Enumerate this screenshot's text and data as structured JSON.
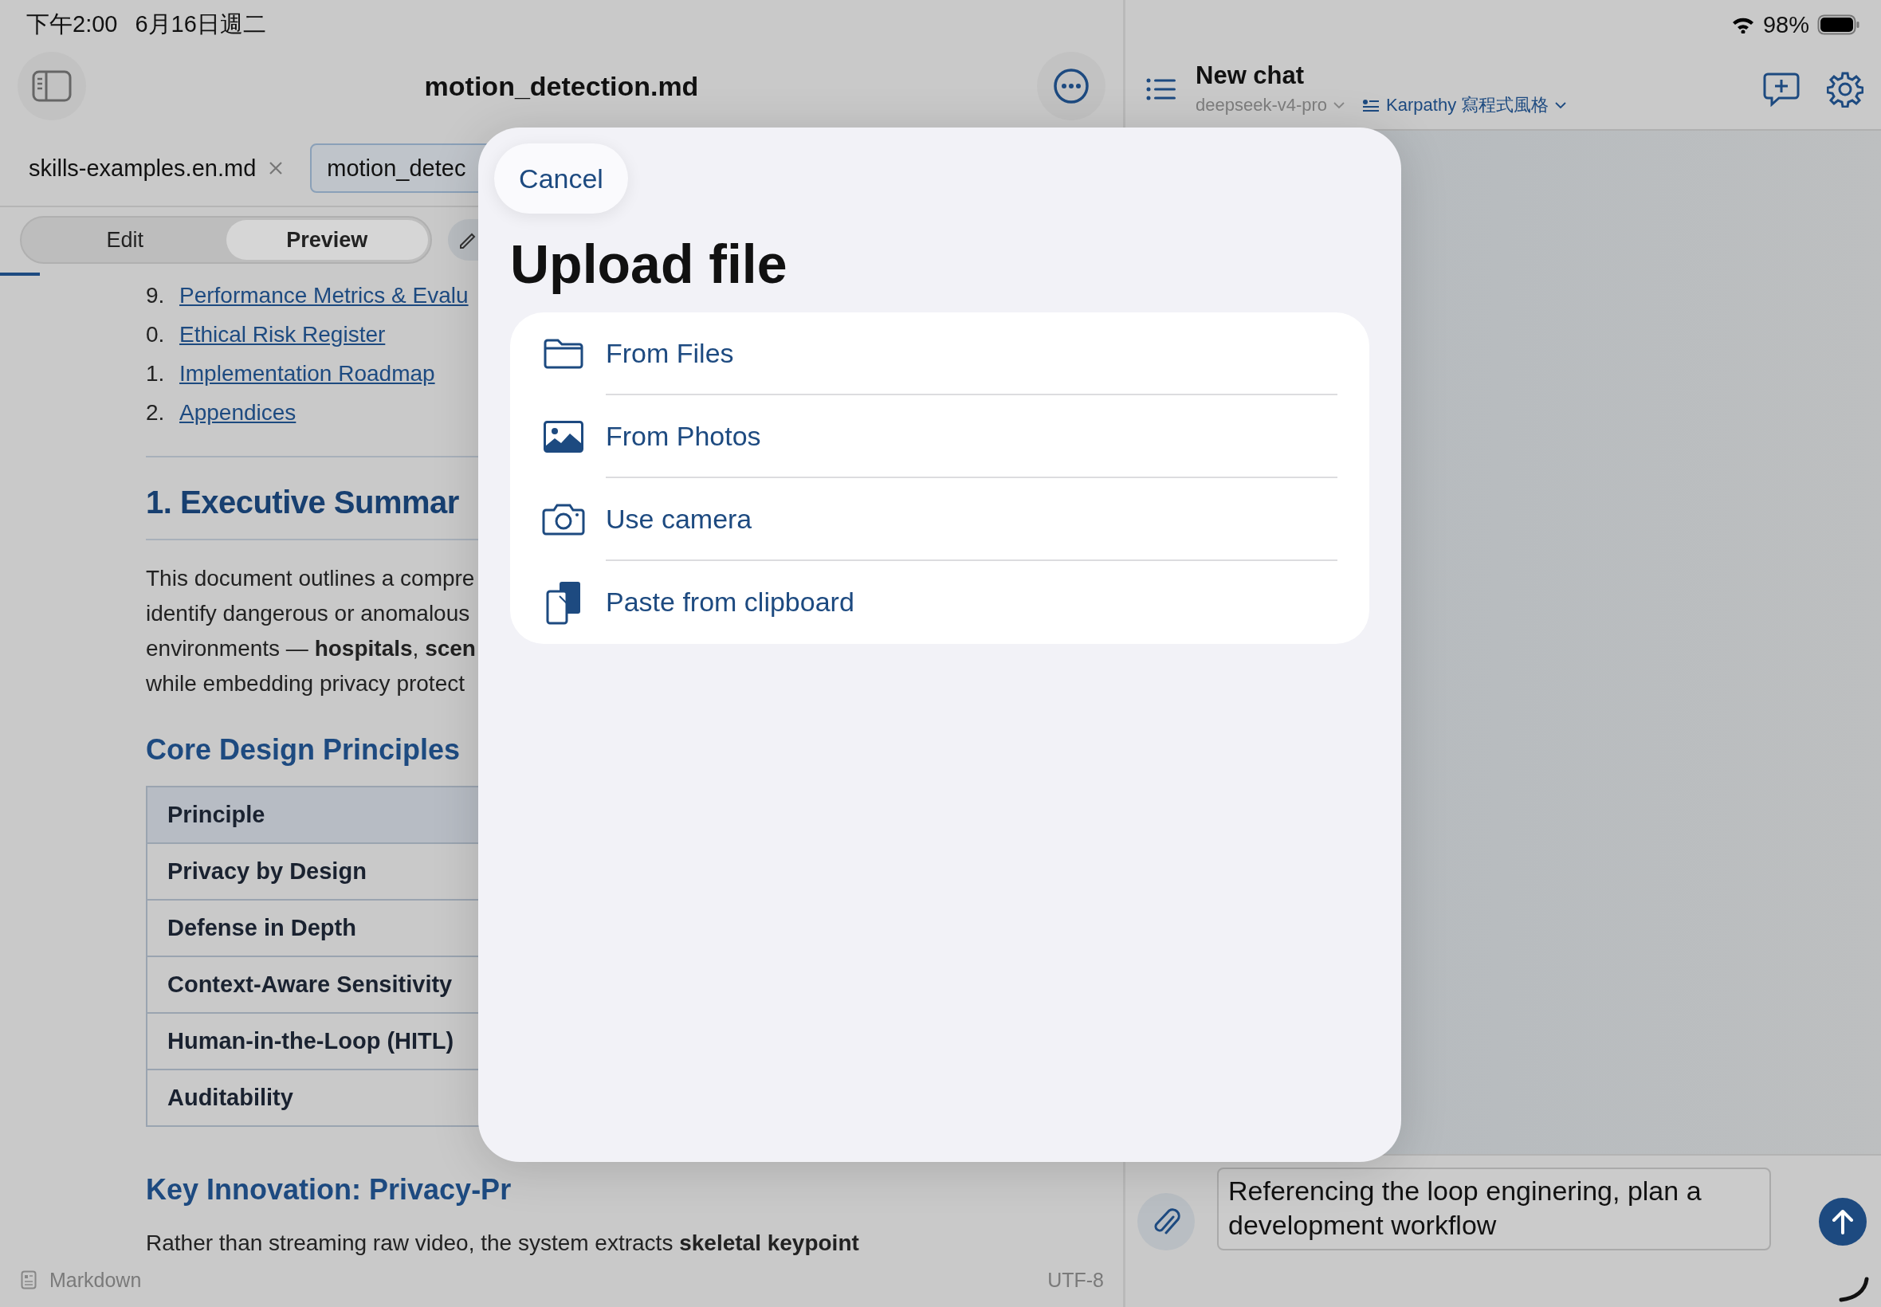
{
  "status_bar": {
    "time": "下午2:00",
    "date": "6月16日週二",
    "battery": "98%"
  },
  "editor": {
    "title": "motion_detection.md",
    "tabs": [
      {
        "label": "skills-examples.en.md",
        "selected": false,
        "closable": true
      },
      {
        "label": "motion_detec",
        "selected": true,
        "closable": false
      }
    ],
    "modes": [
      {
        "label": "Edit",
        "selected": false
      },
      {
        "label": "Preview",
        "selected": true
      }
    ],
    "toc": [
      {
        "number": "9.",
        "label": "Performance Metrics & Evalu"
      },
      {
        "number": "0.",
        "label": "Ethical Risk Register"
      },
      {
        "number": "1.",
        "label": "Implementation Roadmap"
      },
      {
        "number": "2.",
        "label": "Appendices"
      }
    ],
    "heading": "1. Executive Summar",
    "paragraph": [
      "This document outlines a compre",
      "identify dangerous or anomalous",
      "environments — **hospitals**, **scen**",
      "while embedding privacy protect"
    ],
    "subheading": "Core Design Principles",
    "table": {
      "columns": [
        "Principle"
      ],
      "rows": [
        [
          "Privacy by Design"
        ],
        [
          "Defense in Depth"
        ],
        [
          "Context-Aware Sensitivity"
        ],
        [
          "Human-in-the-Loop (HITL)"
        ],
        [
          "Auditability"
        ]
      ]
    },
    "subheading_2": "Key Innovation: Privacy-Pr",
    "paragraph_2": "Rather than streaming raw video, the system extracts **skeletal keypoint**",
    "footer": {
      "language": "Markdown",
      "encoding": "UTF-8"
    }
  },
  "chat": {
    "title": "New chat",
    "model": "deepseek-v4-pro",
    "style": "Karpathy 寫程式風格",
    "message": "Referencing the loop enginering, plan a development workflow"
  },
  "modal": {
    "cancel": "Cancel",
    "title": "Upload file",
    "options": [
      {
        "kind": "files",
        "label": "From Files"
      },
      {
        "kind": "photos",
        "label": "From Photos"
      },
      {
        "kind": "camera",
        "label": "Use camera"
      },
      {
        "kind": "clipboard",
        "label": "Paste from clipboard"
      }
    ]
  }
}
